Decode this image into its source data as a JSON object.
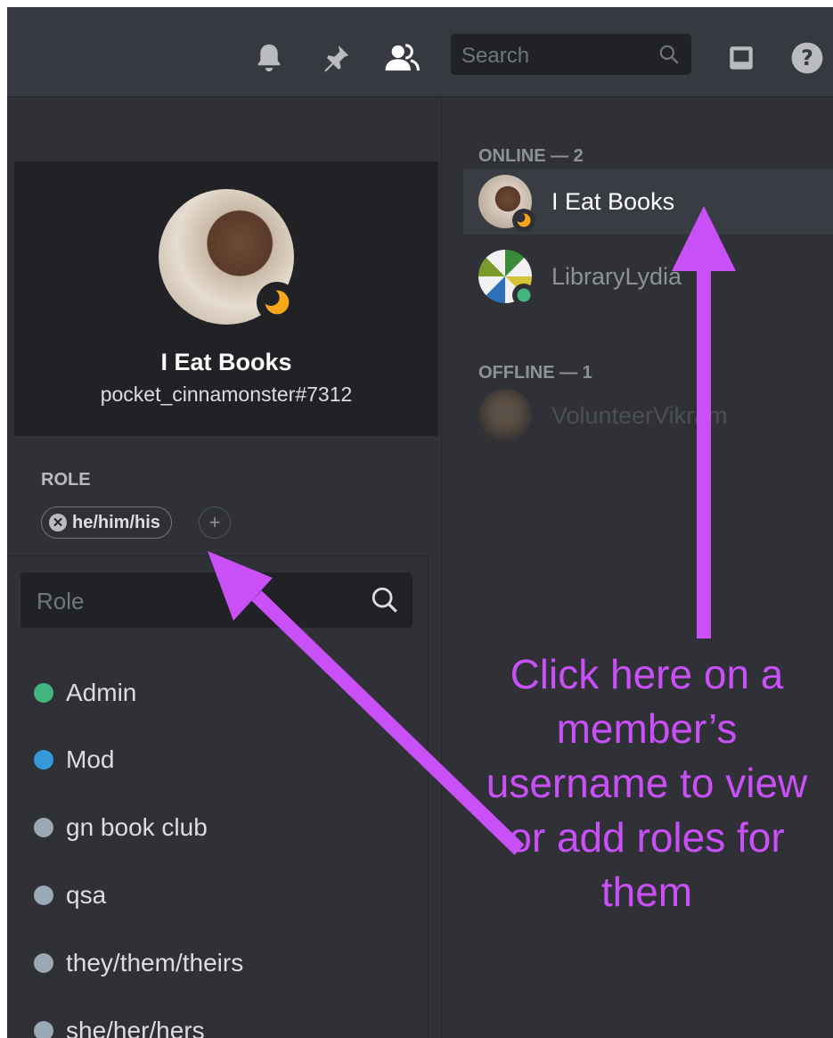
{
  "topbar": {
    "icons": [
      "bell-icon",
      "pin-icon",
      "members-icon",
      "inbox-icon",
      "help-icon"
    ],
    "search_placeholder": "Search"
  },
  "profile": {
    "display_name": "I Eat Books",
    "tag": "pocket_cinnamonster#7312",
    "status": "idle"
  },
  "roles": {
    "heading": "ROLE",
    "assigned": [
      {
        "label": "he/him/his"
      }
    ],
    "search_placeholder": "Role",
    "options": [
      {
        "label": "Admin",
        "color": "#43b581"
      },
      {
        "label": "Mod",
        "color": "#3498db"
      },
      {
        "label": "gn book club",
        "color": "#99aab5"
      },
      {
        "label": "qsa",
        "color": "#99aab5"
      },
      {
        "label": "they/them/theirs",
        "color": "#99aab5"
      },
      {
        "label": "she/her/hers",
        "color": "#99aab5"
      }
    ]
  },
  "members": {
    "online_label": "ONLINE — 2",
    "offline_label": "OFFLINE — 1",
    "online": [
      {
        "name": "I Eat Books",
        "status": "idle"
      },
      {
        "name": "LibraryLydia",
        "status": "online"
      }
    ],
    "offline": [
      {
        "name": "VolunteerVikram"
      }
    ]
  },
  "annotation": {
    "text": "Click here on a member’s username to view or add roles for them",
    "color": "#c94ff7"
  }
}
